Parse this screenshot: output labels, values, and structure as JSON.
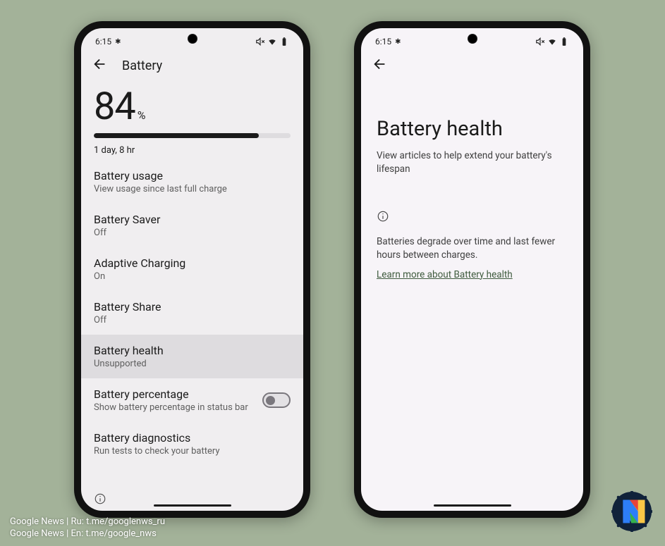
{
  "status": {
    "time": "6:15",
    "asterisk": "✱"
  },
  "left": {
    "appbar_title": "Battery",
    "percent_value": "84",
    "percent_unit": "%",
    "time_remaining": "1 day, 8 hr",
    "items": [
      {
        "title": "Battery usage",
        "sub": "View usage since last full charge"
      },
      {
        "title": "Battery Saver",
        "sub": "Off"
      },
      {
        "title": "Adaptive Charging",
        "sub": "On"
      },
      {
        "title": "Battery Share",
        "sub": "Off"
      },
      {
        "title": "Battery health",
        "sub": "Unsupported"
      },
      {
        "title": "Battery percentage",
        "sub": "Show battery percentage in status bar"
      },
      {
        "title": "Battery diagnostics",
        "sub": "Run tests to check your battery"
      }
    ]
  },
  "right": {
    "title": "Battery health",
    "subtitle": "View articles to help extend your battery's lifespan",
    "info_text": "Batteries degrade over time and last fewer hours between charges.",
    "learn_link": "Learn more about Battery health"
  },
  "watermark": {
    "line1": "Google News | Ru: t.me/googlenws_ru",
    "line2": "Google News | En: t.me/google_nws"
  }
}
